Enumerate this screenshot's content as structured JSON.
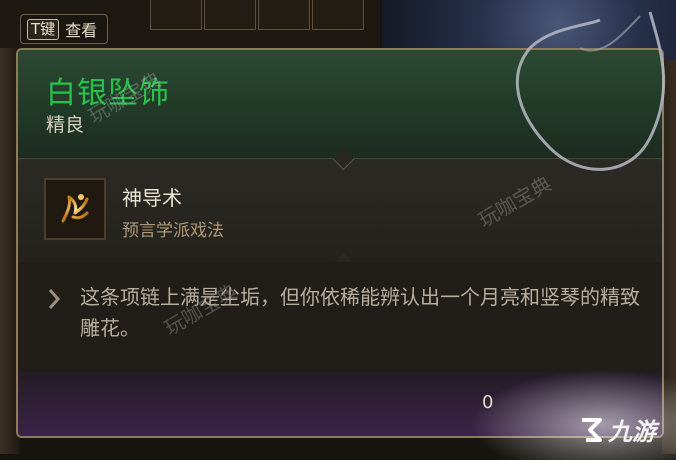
{
  "hint": {
    "key": "T键",
    "label": "查看"
  },
  "item": {
    "name": "白银坠饰",
    "rarity": "精良",
    "name_color": "#27c24a"
  },
  "spell": {
    "name": "神导术",
    "school": "预言学派戏法",
    "icon": "hand-rune-icon"
  },
  "description": {
    "icon": "chevron-icon",
    "text": "这条项链上满是尘垢，但你依稀能辨认出一个月亮和竖琴的精致雕花。"
  },
  "footer": {
    "value": "0"
  },
  "watermarks": [
    "玩咖宝典",
    "玩咖宝典",
    "玩咖宝典"
  ],
  "logo": {
    "text": "九游"
  }
}
